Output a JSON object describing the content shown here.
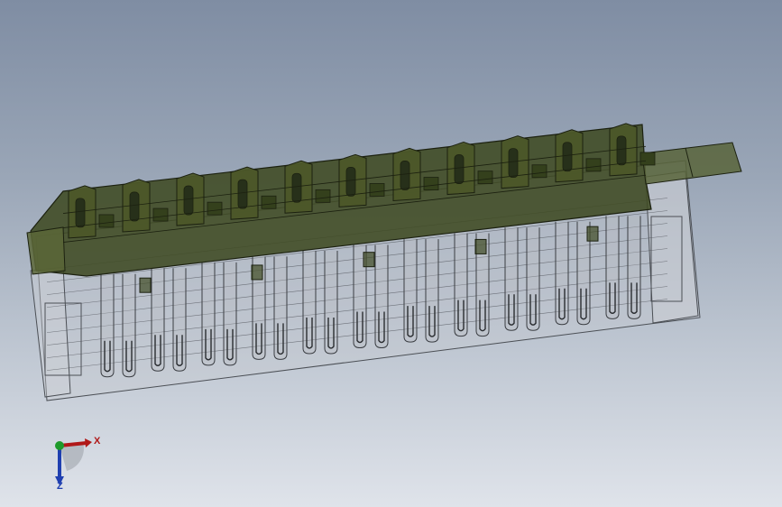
{
  "viewport": {
    "background_top": "#7f8da3",
    "background_bottom": "#dfe3ea"
  },
  "model": {
    "description_icon": "connector-housing-wireframe",
    "upper_color": "#3f4a22",
    "upper_edge_color": "#1c2110",
    "lower_edge_color": "#4b4f55",
    "pin_count": 11
  },
  "triad": {
    "x_label": "X",
    "z_label": "Z",
    "x_color": "#b01818",
    "y_color": "#1e9a2a",
    "z_color": "#1f3fb0"
  }
}
